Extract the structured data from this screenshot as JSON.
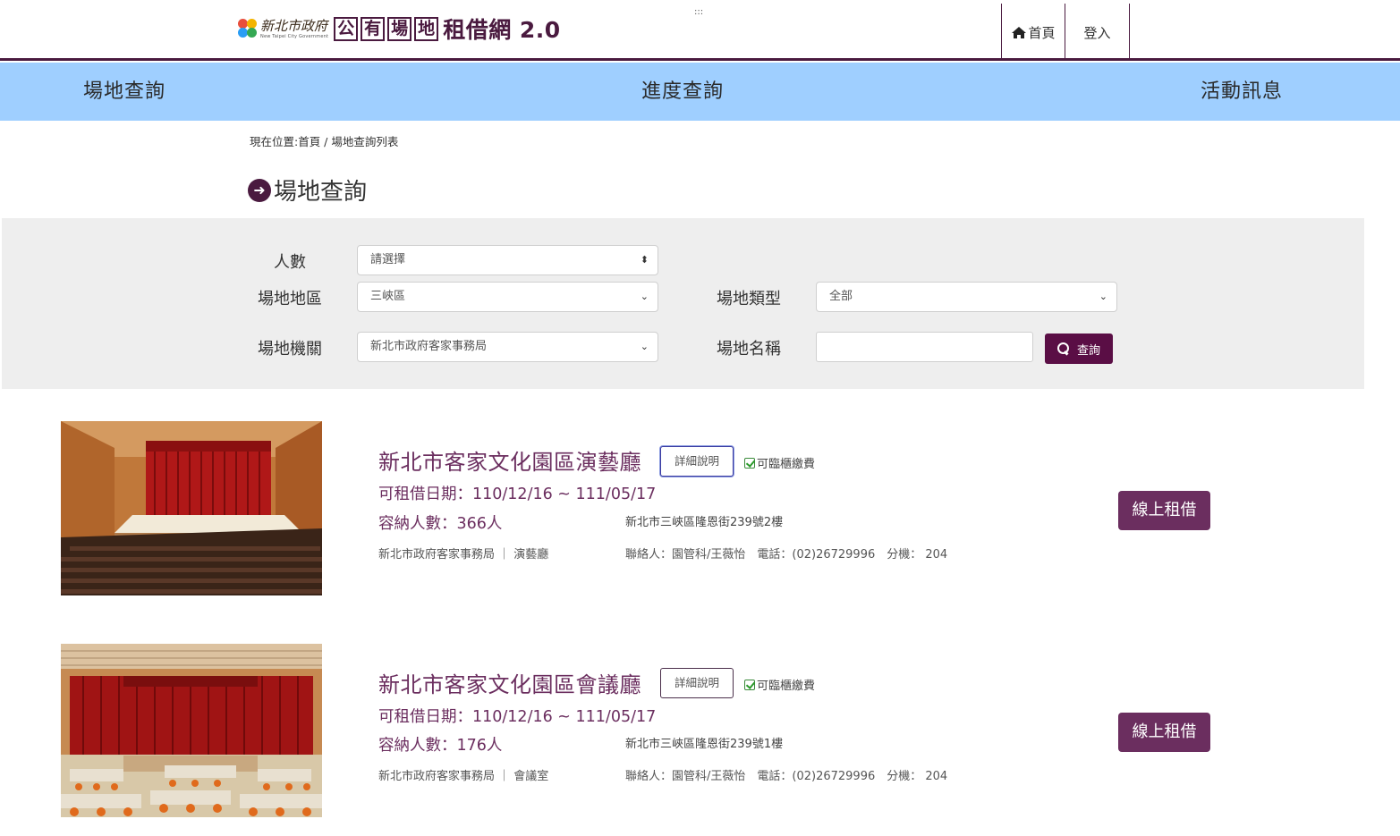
{
  "header": {
    "logo_gov_cn": "新北市政府",
    "logo_gov_en": "New Taipei City Government",
    "logo_box_chars": [
      "公",
      "有",
      "場",
      "地"
    ],
    "logo_rest": "租借網 2.0",
    "dots": ":::",
    "home_label": "首頁",
    "login_label": "登入"
  },
  "menu": {
    "items": [
      "場地查詢",
      "進度查詢",
      "活動訊息"
    ]
  },
  "breadcrumb": "現在位置:首頁 / 場地查詢列表",
  "page_title": "場地查詢",
  "search": {
    "people_label": "人數",
    "people_value": "請選擇",
    "region_label": "場地地區",
    "region_value": "三峽區",
    "type_label": "場地類型",
    "type_value": "全部",
    "agency_label": "場地機關",
    "agency_value": "新北市政府客家事務局",
    "name_label": "場地名稱",
    "name_value": "",
    "query_label": "查詢"
  },
  "venues": [
    {
      "title": "新北市客家文化園區演藝廳",
      "detail_label": "詳細說明",
      "counter_pay": "可臨櫃繳費",
      "date": "可租借日期：110/12/16 ~ 111/05/17",
      "capacity": "容納人數：366人",
      "address": "新北市三峽區隆恩街239號2樓",
      "org": "新北市政府客家事務局 ｜ 演藝廳",
      "contact": "聯絡人：園管科/王薇怡　電話：(02)26729996　分機： 204",
      "rent_label": "線上租借"
    },
    {
      "title": "新北市客家文化園區會議廳",
      "detail_label": "詳細說明",
      "counter_pay": "可臨櫃繳費",
      "date": "可租借日期：110/12/16 ~ 111/05/17",
      "capacity": "容納人數：176人",
      "address": "新北市三峽區隆恩街239號1樓",
      "org": "新北市政府客家事務局 ｜ 會議室",
      "contact": "聯絡人：園管科/王薇怡　電話：(02)26729996　分機： 204",
      "rent_label": "線上租借"
    }
  ],
  "colors": {
    "brand_purple": "#4a1a3f",
    "accent_purple": "#6b2e5f",
    "menu_blue": "#9fcfff",
    "panel_gray": "#eeeeee"
  }
}
